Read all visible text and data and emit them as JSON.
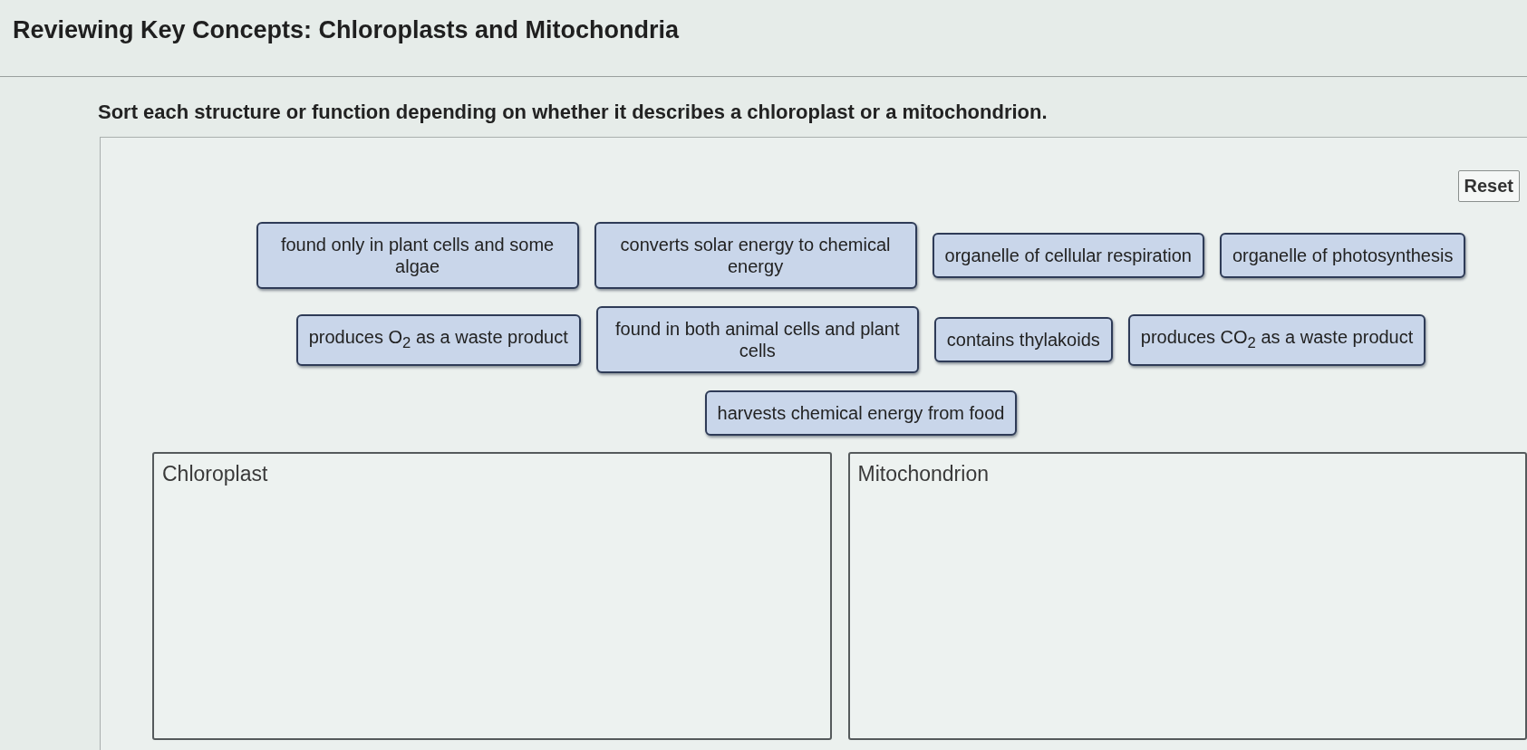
{
  "title": "Reviewing Key Concepts: Chloroplasts and Mitochondria",
  "instructions": "Sort each structure or function depending on whether it describes a chloroplast or a mitochondrion.",
  "reset_button": "Reset",
  "tile_rows": [
    [
      {
        "label": "found only in plant cells and some algae"
      },
      {
        "label": "converts solar energy to chemical energy"
      },
      {
        "label": "organelle of cellular respiration"
      },
      {
        "label": "organelle of photosynthesis"
      }
    ],
    [
      {
        "label": "produces O$_{2}$ as a waste product"
      },
      {
        "label": "found in both animal cells and plant cells"
      },
      {
        "label": "contains thylakoids"
      },
      {
        "label": "produces CO$_{2}$ as a waste product"
      }
    ],
    [
      {
        "label": "harvests chemical energy from food"
      }
    ]
  ],
  "bins": [
    {
      "label": "Chloroplast"
    },
    {
      "label": "Mitochondrion"
    }
  ]
}
